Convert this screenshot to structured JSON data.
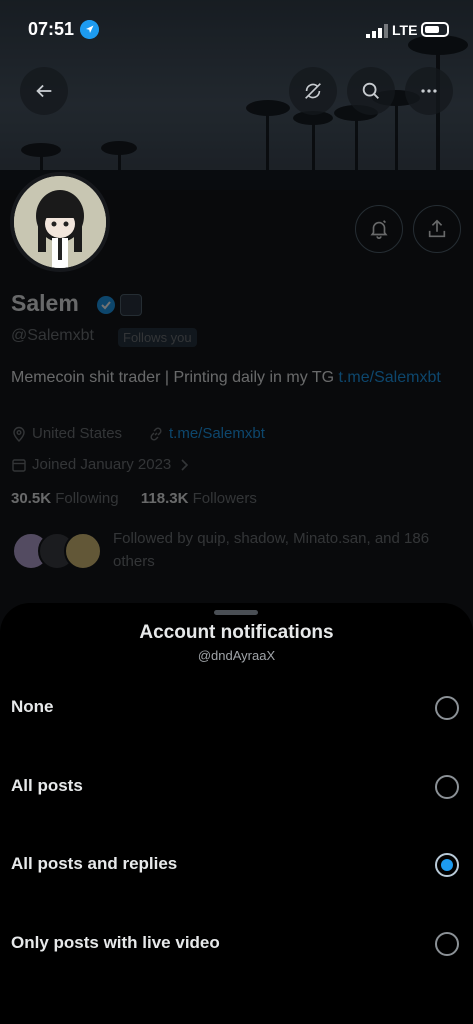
{
  "status_bar": {
    "time": "07:51",
    "network": "LTE"
  },
  "profile": {
    "name": "Salem",
    "handle": "@Salemxbt",
    "follows_you": "Follows you",
    "bio_text": "Memecoin shit trader | Printing daily in my TG ",
    "bio_link": "t.me/Salemxbt",
    "location": "United States",
    "website": "t.me/Salemxbt",
    "joined": "Joined January 2023",
    "following_count": "30.5K",
    "following_label": "Following",
    "followers_count": "118.3K",
    "followers_label": "Followers",
    "followed_by": "Followed by quip, shadow, Minato.san, and 186 others"
  },
  "sheet": {
    "title": "Account notifications",
    "subtitle": "@dndAyraaX",
    "options": [
      {
        "label": "None",
        "selected": false
      },
      {
        "label": "All posts",
        "selected": false
      },
      {
        "label": "All posts and replies",
        "selected": true
      },
      {
        "label": "Only posts with live video",
        "selected": false
      }
    ]
  },
  "colors": {
    "accent": "#1d9bf0",
    "background": "#000000",
    "muted": "#71767b"
  },
  "icons": [
    "location-arrow-icon",
    "back-arrow-icon",
    "sync-off-icon",
    "search-icon",
    "more-icon",
    "bell-notifications-icon",
    "share-icon",
    "verified-badge-icon",
    "location-pin-icon",
    "link-icon",
    "calendar-icon",
    "chevron-right-icon"
  ]
}
